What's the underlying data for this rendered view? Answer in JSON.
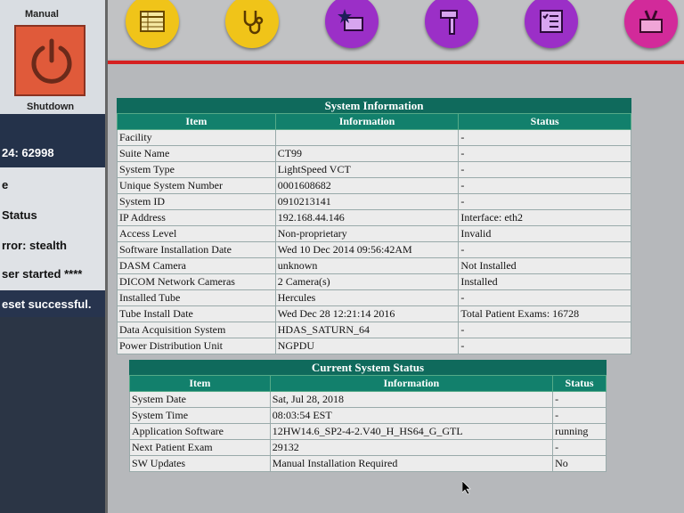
{
  "left": {
    "manual_label": "Manual",
    "shutdown_label": "Shutdown",
    "counter": "24:  62998",
    "lines": [
      "e",
      "Status",
      "rror:  stealth",
      "ser started ****"
    ],
    "reset_message": "eset successful."
  },
  "toolbar": {
    "buttons": [
      {
        "name": "table-icon",
        "color": "#f0c419"
      },
      {
        "name": "stethoscope-icon",
        "color": "#f0c419"
      },
      {
        "name": "star-monitor-icon",
        "color": "#9b2fc7"
      },
      {
        "name": "hammer-icon",
        "color": "#9b2fc7"
      },
      {
        "name": "checklist-icon",
        "color": "#9b2fc7"
      },
      {
        "name": "toolbox-icon",
        "color": "#d22a9a"
      }
    ]
  },
  "system_information": {
    "title": "System Information",
    "headers": [
      "Item",
      "Information",
      "Status"
    ],
    "rows": [
      [
        "Facility",
        "",
        "-"
      ],
      [
        "Suite Name",
        "CT99",
        "-"
      ],
      [
        "System Type",
        "LightSpeed VCT",
        "-"
      ],
      [
        "Unique System Number",
        "0001608682",
        "-"
      ],
      [
        "System ID",
        "0910213141",
        "-"
      ],
      [
        "IP Address",
        "192.168.44.146",
        "Interface: eth2"
      ],
      [
        "Access Level",
        "Non-proprietary",
        "Invalid"
      ],
      [
        "Software Installation Date",
        "Wed 10 Dec 2014 09:56:42AM",
        "-"
      ],
      [
        "DASM Camera",
        "unknown",
        "Not Installed"
      ],
      [
        "DICOM Network Cameras",
        "2 Camera(s)",
        "Installed"
      ],
      [
        "Installed Tube",
        "Hercules",
        "-"
      ],
      [
        "Tube Install Date",
        "Wed Dec 28 12:21:14 2016",
        "Total Patient Exams: 16728"
      ],
      [
        "Data Acquisition System",
        "HDAS_SATURN_64",
        "-"
      ],
      [
        "Power Distribution Unit",
        "NGPDU",
        "-"
      ]
    ]
  },
  "current_status": {
    "title": "Current System Status",
    "headers": [
      "Item",
      "Information",
      "Status"
    ],
    "rows": [
      [
        "System Date",
        "Sat, Jul 28, 2018",
        "-"
      ],
      [
        "System Time",
        "08:03:54 EST",
        "-"
      ],
      [
        "Application Software",
        "12HW14.6_SP2-4-2.V40_H_HS64_G_GTL",
        "running"
      ],
      [
        "Next Patient Exam",
        "29132",
        "-"
      ],
      [
        "SW Updates",
        "Manual Installation Required",
        "No"
      ]
    ]
  }
}
